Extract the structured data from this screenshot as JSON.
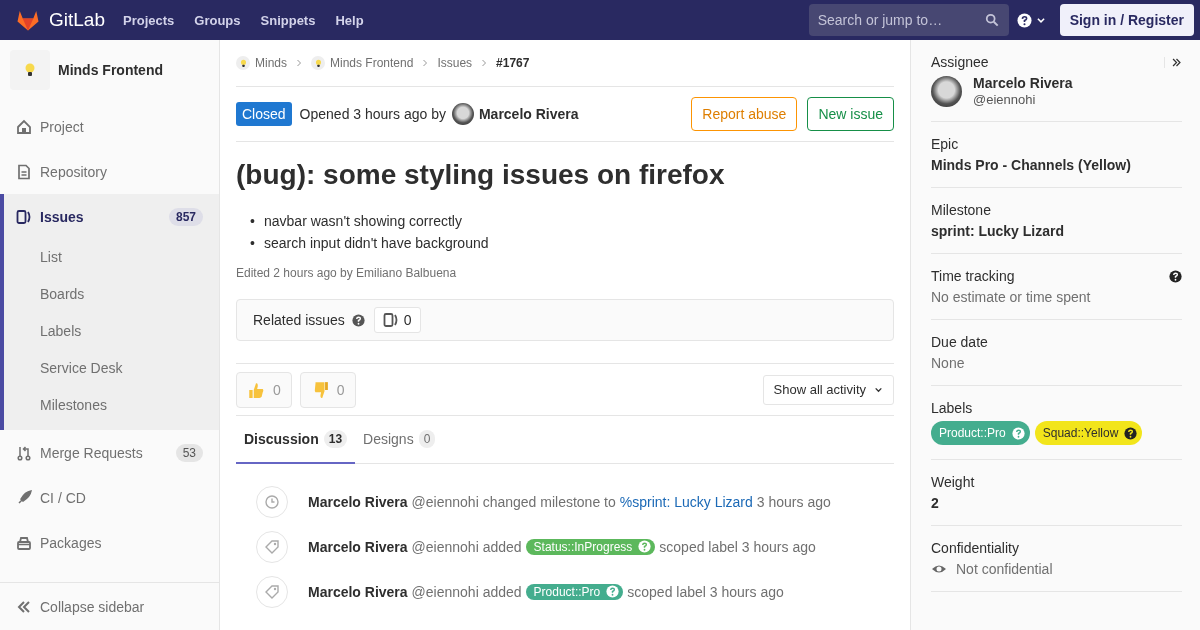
{
  "navbar": {
    "brand": "GitLab",
    "links": [
      "Projects",
      "Groups",
      "Snippets",
      "Help"
    ],
    "search": {
      "placeholder": "Search or jump to…"
    },
    "sign_in": "Sign in / Register"
  },
  "sidebar": {
    "project": "Minds Frontend",
    "items": [
      {
        "label": "Project",
        "selected": false
      },
      {
        "label": "Repository",
        "selected": false
      },
      {
        "label": "Issues",
        "count": "857",
        "selected": true,
        "children": [
          {
            "label": "List"
          },
          {
            "label": "Boards"
          },
          {
            "label": "Labels"
          },
          {
            "label": "Service Desk"
          },
          {
            "label": "Milestones"
          }
        ]
      },
      {
        "label": "Merge Requests",
        "count": "53",
        "selected": false
      },
      {
        "label": "CI / CD",
        "selected": false
      },
      {
        "label": "Packages",
        "selected": false
      }
    ],
    "collapse": "Collapse sidebar"
  },
  "breadcrumbs": [
    {
      "label": "Minds",
      "kind": "group",
      "current": false
    },
    {
      "label": "Minds Frontend",
      "kind": "group",
      "current": false
    },
    {
      "label": "Issues",
      "kind": "page",
      "current": false
    },
    {
      "label": "#1767",
      "kind": "page",
      "current": true
    }
  ],
  "issue": {
    "status": "Closed",
    "opened": "Opened 3 hours ago by",
    "author": "Marcelo Rivera",
    "buttons": [
      {
        "label": "Report abuse",
        "kind": "warning"
      },
      {
        "label": "New issue",
        "kind": "success"
      }
    ],
    "title": "(bug): some styling issues on firefox",
    "bullets": [
      {
        "marker": "•",
        "text": "navbar wasn't showing correctly"
      },
      {
        "marker": "•",
        "text": "search input didn't have background"
      }
    ],
    "edited": "Edited 2 hours ago by Emiliano Balbuena"
  },
  "related": {
    "label": "Related issues",
    "count": "0"
  },
  "awards": [
    {
      "kind": "thumbsup",
      "count": "0"
    },
    {
      "kind": "thumbsdown",
      "count": "0"
    }
  ],
  "activity_filter": "Show all activity",
  "tabs": [
    {
      "label": "Discussion",
      "count": "13",
      "selected": true
    },
    {
      "label": "Designs",
      "count": "0",
      "selected": false
    }
  ],
  "notes": [
    {
      "kind": "milestone",
      "author": "Marcelo Rivera",
      "parts": [
        {
          "kind": "text",
          "text": "@eiennohi changed milestone to"
        },
        {
          "kind": "link",
          "text": "%sprint: Lucky Lizard"
        },
        {
          "kind": "text",
          "text": "3 hours ago"
        }
      ]
    },
    {
      "kind": "label",
      "author": "Marcelo Rivera",
      "parts": [
        {
          "kind": "text",
          "text": "@eiennohi added"
        },
        {
          "kind": "label",
          "text": "Status::InProgress",
          "color": "#5cb85c"
        },
        {
          "kind": "text",
          "text": "scoped label 3 hours ago"
        }
      ]
    },
    {
      "kind": "label",
      "author": "Marcelo Rivera",
      "parts": [
        {
          "kind": "text",
          "text": "@eiennohi added"
        },
        {
          "kind": "label",
          "text": "Product::Pro",
          "color": "#44ad8e"
        },
        {
          "kind": "text",
          "text": "scoped label 3 hours ago"
        }
      ]
    }
  ],
  "right_sidebar": [
    {
      "kind": "user",
      "title": "Assignee",
      "name": "Marcelo Rivera",
      "handle": "@eiennohi"
    },
    {
      "kind": "value",
      "title": "Epic",
      "value": "Minds Pro - Channels (Yellow)"
    },
    {
      "kind": "value",
      "title": "Milestone",
      "value": "sprint: Lucky Lizard"
    },
    {
      "kind": "help",
      "title": "Time tracking",
      "value": "No estimate or time spent"
    },
    {
      "kind": "muted",
      "title": "Due date",
      "value": "None"
    },
    {
      "kind": "labels",
      "title": "Labels",
      "labels": [
        {
          "text": "Product::Pro",
          "color": "#44ad8e"
        },
        {
          "text": "Squad::Yellow",
          "color": "#f2e51b"
        }
      ]
    },
    {
      "kind": "value",
      "title": "Weight",
      "value": "2"
    },
    {
      "kind": "eye",
      "title": "Confidentiality",
      "value": "Not confidential"
    }
  ]
}
